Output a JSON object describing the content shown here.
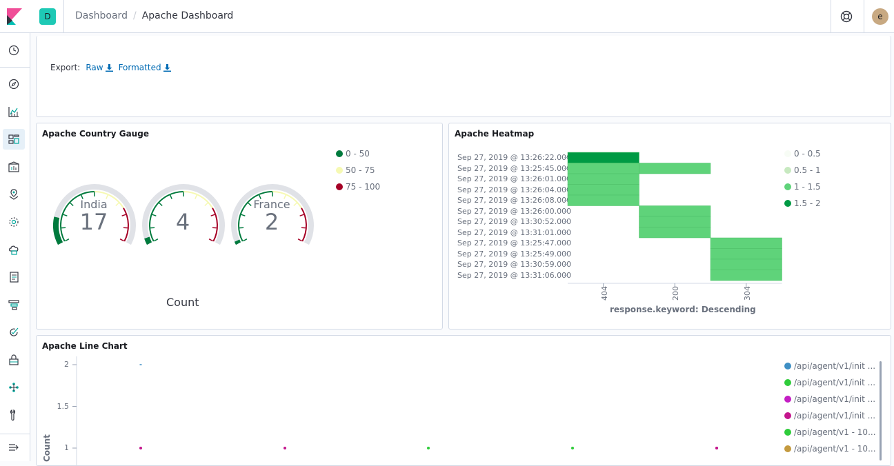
{
  "header": {
    "space_initial": "D",
    "breadcrumb_parent": "Dashboard",
    "breadcrumb_separator": "/",
    "breadcrumb_current": "Apache Dashboard",
    "user_initial": "e"
  },
  "sidenav": {
    "items": [
      {
        "icon": "clock-icon"
      },
      {
        "icon": "compass-icon"
      },
      {
        "icon": "visualize-icon"
      },
      {
        "icon": "dashboard-icon",
        "active": true
      },
      {
        "icon": "canvas-icon"
      },
      {
        "icon": "maps-icon"
      },
      {
        "icon": "ml-icon"
      },
      {
        "icon": "infrastructure-icon"
      },
      {
        "icon": "logs-icon"
      },
      {
        "icon": "apm-icon"
      },
      {
        "icon": "uptime-icon"
      },
      {
        "icon": "siem-icon"
      },
      {
        "icon": "dev-tools-icon"
      },
      {
        "icon": "monitoring-icon"
      },
      {
        "icon": "collapse-icon"
      }
    ]
  },
  "export_panel": {
    "label": "Export:",
    "raw": "Raw",
    "formatted": "Formatted"
  },
  "gauge_panel": {
    "title": "Apache Country Gauge",
    "legend": [
      {
        "label": "0 - 50",
        "color": "#007a3d"
      },
      {
        "label": "50 - 75",
        "color": "#f6f9b3"
      },
      {
        "label": "75 - 100",
        "color": "#a50026"
      }
    ],
    "gauges": [
      {
        "label": "India",
        "value": "17"
      },
      {
        "label": "",
        "value": "4"
      },
      {
        "label": "France",
        "value": "2"
      }
    ],
    "caption": "Count",
    "colors": {
      "track": "#e0e2e7",
      "low": "#007a3d",
      "mid": "#f6f9b3",
      "high": "#a50026"
    }
  },
  "heatmap_panel": {
    "title": "Apache Heatmap",
    "y_labels": [
      "Sep 27, 2019 @ 13:26:22.000",
      "Sep 27, 2019 @ 13:25:45.000",
      "Sep 27, 2019 @ 13:26:01.000",
      "Sep 27, 2019 @ 13:26:04.000",
      "Sep 27, 2019 @ 13:26:08.000",
      "Sep 27, 2019 @ 13:26:00.000",
      "Sep 27, 2019 @ 13:30:52.000",
      "Sep 27, 2019 @ 13:31:01.000",
      "Sep 27, 2019 @ 13:25:47.000",
      "Sep 27, 2019 @ 13:25:49.000",
      "Sep 27, 2019 @ 13:30:59.000",
      "Sep 27, 2019 @ 13:31:06.000"
    ],
    "x_labels": [
      "404",
      "200",
      "304"
    ],
    "x_axis_title": "response.keyword: Descending",
    "cells": [
      [
        2,
        0,
        0
      ],
      [
        1,
        1,
        0
      ],
      [
        1,
        0,
        0
      ],
      [
        1,
        0,
        0
      ],
      [
        1,
        0,
        0
      ],
      [
        0,
        1,
        0
      ],
      [
        0,
        1,
        0
      ],
      [
        0,
        1,
        0
      ],
      [
        0,
        0,
        1
      ],
      [
        0,
        0,
        1
      ],
      [
        0,
        0,
        1
      ],
      [
        0,
        0,
        1
      ]
    ],
    "legend": [
      {
        "label": "0 - 0.5",
        "color": "#f7fcf5"
      },
      {
        "label": "0.5 - 1",
        "color": "#c7e9c0"
      },
      {
        "label": "1 - 1.5",
        "color": "#5fd37a"
      },
      {
        "label": "1.5 - 2",
        "color": "#009a44"
      }
    ]
  },
  "line_panel": {
    "title": "Apache Line Chart",
    "y_axis_title": "Count",
    "y_ticks": [
      "2",
      "1.5",
      "1"
    ],
    "legend": [
      {
        "label": "/api/agent/v1/init ...",
        "color": "#3f8fc4"
      },
      {
        "label": "/api/agent/v1/init ...",
        "color": "#2fcc3b"
      },
      {
        "label": "/api/agent/v1/init ...",
        "color": "#c41ec4"
      },
      {
        "label": "/api/agent/v1/init ...",
        "color": "#c4168d"
      },
      {
        "label": "/api/agent/v1 - 10...",
        "color": "#2fcc3b"
      },
      {
        "label": "/api/agent/v1 - 10...",
        "color": "#c49a3f"
      }
    ]
  },
  "chart_data": [
    {
      "type": "heatmap",
      "title": "Apache Heatmap",
      "x": [
        "404",
        "200",
        "304"
      ],
      "y": [
        "Sep 27, 2019 @ 13:26:22.000",
        "Sep 27, 2019 @ 13:25:45.000",
        "Sep 27, 2019 @ 13:26:01.000",
        "Sep 27, 2019 @ 13:26:04.000",
        "Sep 27, 2019 @ 13:26:08.000",
        "Sep 27, 2019 @ 13:26:00.000",
        "Sep 27, 2019 @ 13:30:52.000",
        "Sep 27, 2019 @ 13:31:01.000",
        "Sep 27, 2019 @ 13:25:47.000",
        "Sep 27, 2019 @ 13:25:49.000",
        "Sep 27, 2019 @ 13:30:59.000",
        "Sep 27, 2019 @ 13:31:06.000"
      ],
      "xlabel": "response.keyword: Descending",
      "values": [
        [
          2,
          0,
          0
        ],
        [
          1,
          1,
          0
        ],
        [
          1,
          0,
          0
        ],
        [
          1,
          0,
          0
        ],
        [
          1,
          0,
          0
        ],
        [
          0,
          1,
          0
        ],
        [
          0,
          1,
          0
        ],
        [
          0,
          1,
          0
        ],
        [
          0,
          0,
          1
        ],
        [
          0,
          0,
          1
        ],
        [
          0,
          0,
          1
        ],
        [
          0,
          0,
          1
        ]
      ]
    },
    {
      "type": "scatter",
      "title": "Apache Line Chart",
      "ylabel": "Count",
      "ylim": [
        1,
        2
      ],
      "points": [
        {
          "series": 0,
          "y": 2
        },
        {
          "series": 3,
          "y": 1
        },
        {
          "series": 3,
          "y": 1
        },
        {
          "series": 1,
          "y": 1
        },
        {
          "series": 1,
          "y": 1
        },
        {
          "series": 3,
          "y": 1
        }
      ]
    }
  ]
}
